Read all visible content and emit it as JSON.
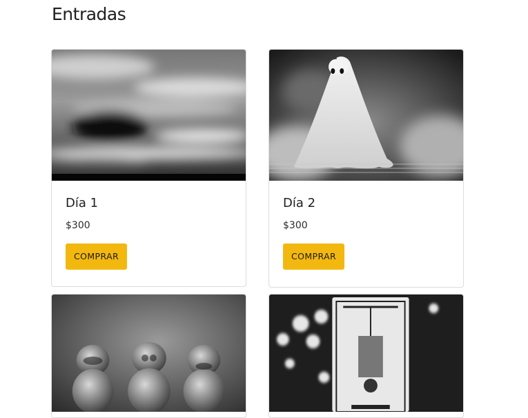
{
  "header": {
    "title": "Entradas"
  },
  "cards": [
    {
      "title": "Día 1",
      "price": "$300",
      "button": "COMPRAR",
      "image": "blurred-sky-photo"
    },
    {
      "title": "Día 2",
      "price": "$300",
      "button": "COMPRAR",
      "image": "ghost-sheet-photo"
    },
    {
      "image": "three-wise-monkeys-photo"
    },
    {
      "image": "tarot-hanged-man-photo"
    }
  ],
  "colors": {
    "button_bg": "#f3b80f",
    "card_border": "#dcdcdc"
  }
}
